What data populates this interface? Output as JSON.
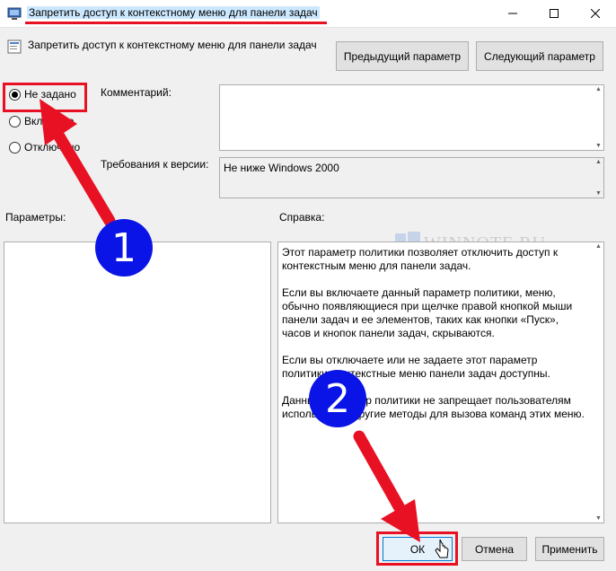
{
  "window": {
    "title": "Запретить доступ к контекстному меню для панели задач"
  },
  "header": {
    "policy_title": "Запретить доступ к контекстному меню для панели задач",
    "prev_button": "Предыдущий параметр",
    "next_button": "Следующий параметр"
  },
  "state_options": [
    {
      "label": "Не задано",
      "selected": true
    },
    {
      "label": "Включено",
      "selected": false
    },
    {
      "label": "Отключено",
      "selected": false
    }
  ],
  "comment": {
    "label": "Комментарий:",
    "value": ""
  },
  "supported": {
    "label": "Требования к версии:",
    "value": "Не ниже Windows 2000"
  },
  "options_label": "Параметры:",
  "help_label": "Справка:",
  "help_text": [
    "Этот параметр политики позволяет отключить доступ к контекстным меню для панели задач.",
    "Если вы включаете данный параметр политики, меню, обычно появляющиеся при щелчке правой кнопкой мыши панели задач и ее элементов, таких как кнопки «Пуск», часов и кнопок панели задач, скрываются.",
    "Если вы отключаете или не задаете этот параметр политики, контекстные меню панели задач доступны.",
    "Данный параметр политики не запрещает пользователям использовать другие методы для вызова команд этих меню."
  ],
  "watermark": "WINNOTE.RU",
  "footer": {
    "ok": "ОК",
    "cancel": "Отмена",
    "apply": "Применить"
  },
  "annotations": {
    "badge_1": "1",
    "badge_2": "2",
    "highlight_color": "#e81123",
    "badge_color": "#0a14e6"
  },
  "icons": [
    "app-icon",
    "policy-icon",
    "minimize-icon",
    "maximize-icon",
    "close-icon",
    "cursor-icon"
  ]
}
